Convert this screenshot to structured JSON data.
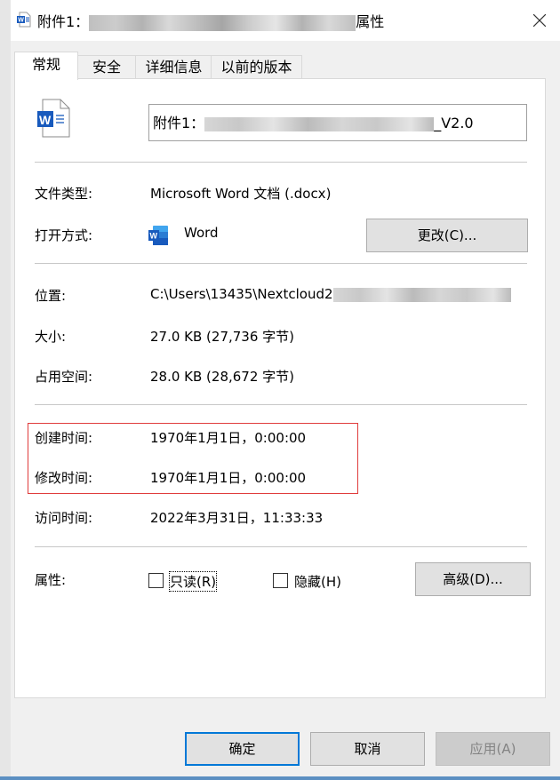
{
  "window": {
    "title_prefix": "附件1：",
    "title_suffix": "属性",
    "close_label": "×"
  },
  "tabs": [
    {
      "label": "常规",
      "active": true
    },
    {
      "label": "安全",
      "active": false
    },
    {
      "label": "详细信息",
      "active": false
    },
    {
      "label": "以前的版本",
      "active": false
    }
  ],
  "general": {
    "file_name_prefix": "附件1：",
    "file_name_suffix": "_V2.0",
    "file_type_label": "文件类型:",
    "file_type_value": "Microsoft Word 文档 (.docx)",
    "open_with_label": "打开方式:",
    "open_with_value": "Word",
    "change_button": "更改(C)...",
    "location_label": "位置:",
    "location_value": "C:\\Users\\13435\\Nextcloud2",
    "size_label": "大小:",
    "size_value": "27.0 KB (27,736 字节)",
    "disk_size_label": "占用空间:",
    "disk_size_value": "28.0 KB (28,672 字节)",
    "created_label": "创建时间:",
    "created_value": "1970年1月1日，0:00:00",
    "modified_label": "修改时间:",
    "modified_value": "1970年1月1日，0:00:00",
    "accessed_label": "访问时间:",
    "accessed_value": "2022年3月31日，11:33:33",
    "attributes_label": "属性:",
    "readonly_label": "只读(R)",
    "readonly_checked": false,
    "hidden_label": "隐藏(H)",
    "hidden_checked": false,
    "advanced_button": "高级(D)..."
  },
  "footer": {
    "ok": "确定",
    "cancel": "取消",
    "apply": "应用(A)"
  },
  "colors": {
    "word_blue": "#185abd",
    "highlight_red": "#e03c3c",
    "focus_blue": "#0078d7"
  }
}
